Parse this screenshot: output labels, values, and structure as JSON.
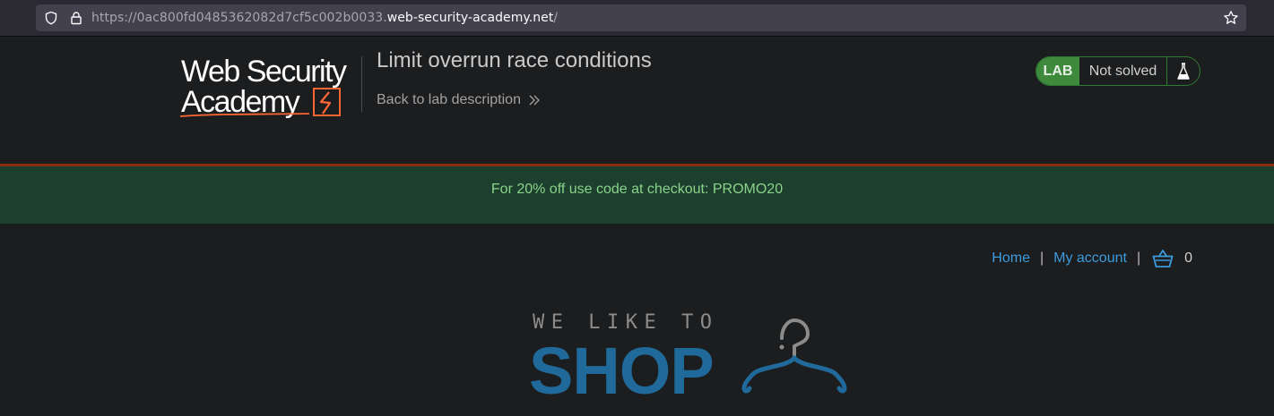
{
  "browser": {
    "url_prefix": "https://0ac800fd0485362082d7cf5c002b0033.",
    "url_host": "web-security-academy.net",
    "url_suffix": "/"
  },
  "academy": {
    "logo_line1": "Web Security",
    "logo_line2": "Academy",
    "lab_title": "Limit overrun race conditions",
    "back_link": "Back to lab description",
    "lab_badge": "LAB",
    "lab_status": "Not solved"
  },
  "promo": {
    "text": "For 20% off use code at checkout: PROMO20"
  },
  "nav": {
    "home": "Home",
    "my_account": "My account",
    "separator": "|",
    "cart_count": "0"
  },
  "shop_logo": {
    "tagline": "WE LIKE TO",
    "word": "SHOP"
  },
  "colors": {
    "lab_green": "#3d8a3d",
    "promo_bg": "#1d3f2d",
    "promo_text": "#8ad38a",
    "link_blue": "#3b9bdd",
    "shop_blue": "#1f6a9a",
    "promo_border": "#8a2d0d"
  },
  "icons": [
    "shield-icon",
    "lock-icon",
    "star-icon",
    "chevron-double-right-icon",
    "flask-icon",
    "basket-icon",
    "hanger-icon"
  ]
}
